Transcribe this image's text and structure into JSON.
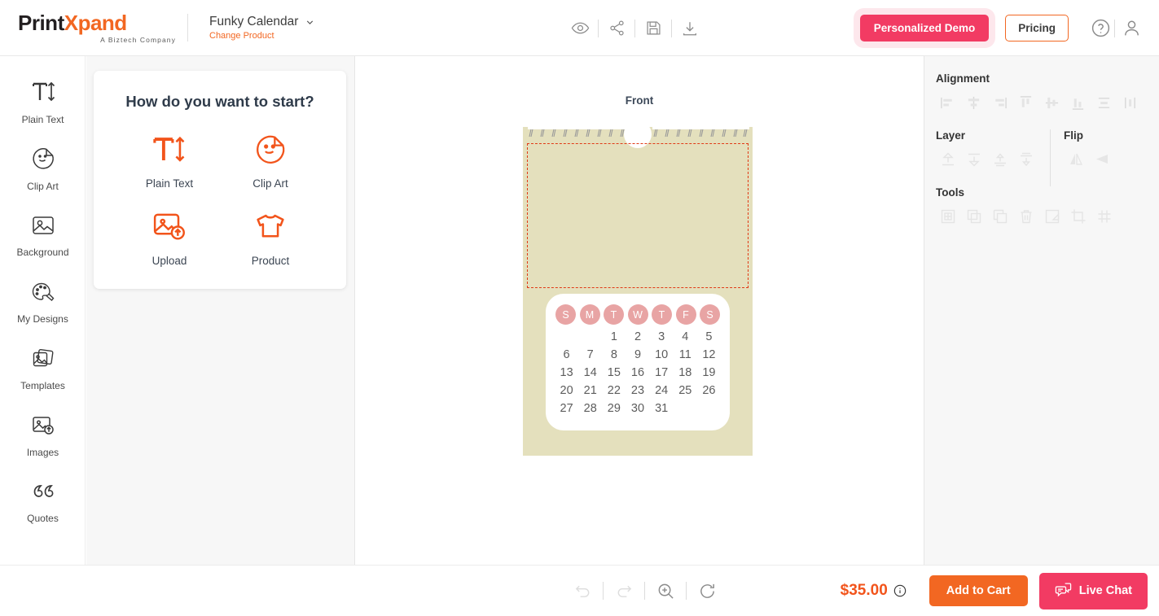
{
  "header": {
    "logo": {
      "part1": "Print",
      "part2": "X",
      "part3": "pand",
      "tagline": "A Biztech Company"
    },
    "product_name": "Funky Calendar",
    "change_product": "Change Product",
    "center_icons": [
      {
        "name": "preview-eye-icon",
        "label": "Preview"
      },
      {
        "name": "share-icon",
        "label": "Share"
      },
      {
        "name": "save-icon",
        "label": "Save"
      },
      {
        "name": "download-icon",
        "label": "Download"
      }
    ],
    "demo_button": "Personalized Demo",
    "pricing_button": "Pricing",
    "help_icon": "help-circle-icon",
    "account_icon": "user-account-icon"
  },
  "sidebar": {
    "items": [
      {
        "label": "Plain Text",
        "icon": "plain-text-icon"
      },
      {
        "label": "Clip Art",
        "icon": "clip-art-icon"
      },
      {
        "label": "Background",
        "icon": "background-icon"
      },
      {
        "label": "My Designs",
        "icon": "my-designs-icon"
      },
      {
        "label": "Templates",
        "icon": "templates-icon"
      },
      {
        "label": "Images",
        "icon": "images-icon"
      },
      {
        "label": "Quotes",
        "icon": "quotes-icon"
      }
    ]
  },
  "start_panel": {
    "title": "How do you want to start?",
    "options": [
      {
        "label": "Plain Text",
        "icon": "plain-text-icon"
      },
      {
        "label": "Clip Art",
        "icon": "clip-art-icon"
      },
      {
        "label": "Upload",
        "icon": "upload-image-icon"
      },
      {
        "label": "Product",
        "icon": "product-tshirt-icon"
      }
    ]
  },
  "canvas": {
    "side_label": "Front",
    "calendar": {
      "body_color": "#e4e0bd",
      "accent_color": "#e8a4a4",
      "print_area_color": "#e03a16",
      "day_headers": [
        "S",
        "M",
        "T",
        "W",
        "T",
        "F",
        "S"
      ],
      "leading_blanks": 2,
      "days": [
        1,
        2,
        3,
        4,
        5,
        6,
        7,
        8,
        9,
        10,
        11,
        12,
        13,
        14,
        15,
        16,
        17,
        18,
        19,
        20,
        21,
        22,
        23,
        24,
        25,
        26,
        27,
        28,
        29,
        30,
        31
      ]
    }
  },
  "right_panel": {
    "alignment": {
      "title": "Alignment",
      "icons": [
        "align-left-icon",
        "align-center-horizontal-icon",
        "align-right-icon",
        "align-top-icon",
        "align-middle-vertical-icon",
        "align-bottom-icon",
        "distribute-horizontal-icon",
        "distribute-vertical-icon"
      ]
    },
    "layer": {
      "title": "Layer",
      "icons": [
        "bring-to-front-icon",
        "send-to-back-icon",
        "bring-forward-icon",
        "send-backward-icon"
      ]
    },
    "flip": {
      "title": "Flip",
      "icons": [
        "flip-horizontal-icon",
        "flip-vertical-icon"
      ]
    },
    "tools": {
      "title": "Tools",
      "icons": [
        "select-all-icon",
        "duplicate-icon",
        "copy-icon",
        "delete-trash-icon",
        "resize-icon",
        "crop-icon",
        "grid-icon"
      ]
    }
  },
  "bottom_bar": {
    "tools": [
      {
        "name": "undo-icon",
        "label": "Undo"
      },
      {
        "name": "redo-icon",
        "label": "Redo"
      },
      {
        "name": "zoom-in-icon",
        "label": "Zoom"
      },
      {
        "name": "reset-refresh-icon",
        "label": "Reset"
      }
    ],
    "price": "$35.00",
    "price_info_icon": "info-circle-icon",
    "add_to_cart": "Add to Cart",
    "live_chat": "Live Chat",
    "live_chat_icon": "chat-bubble-icon"
  }
}
